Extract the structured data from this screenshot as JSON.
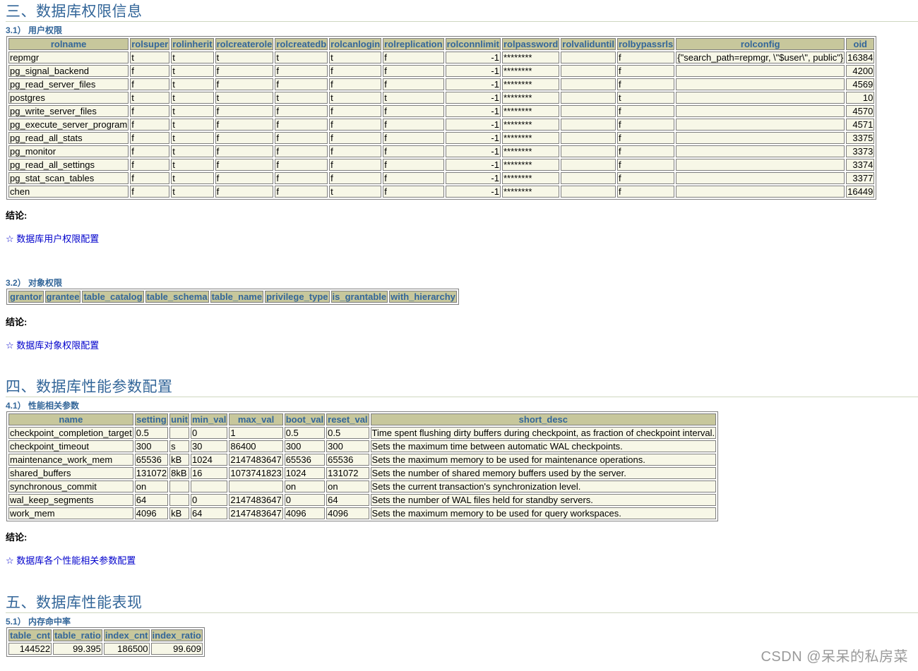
{
  "s3": {
    "title": "三、数据库权限信息",
    "s31": {
      "title": "3.1） 用户权限",
      "headers": [
        "rolname",
        "rolsuper",
        "rolinherit",
        "rolcreaterole",
        "rolcreatedb",
        "rolcanlogin",
        "rolreplication",
        "rolconnlimit",
        "rolpassword",
        "rolvaliduntil",
        "rolbypassrls",
        "rolconfig",
        "oid"
      ],
      "rows": [
        [
          "repmgr",
          "t",
          "t",
          "t",
          "t",
          "t",
          "f",
          "-1",
          "********",
          "",
          "f",
          "{\"search_path=repmgr, \\\"$user\\\", public\"}",
          "16384"
        ],
        [
          "pg_signal_backend",
          "f",
          "t",
          "f",
          "f",
          "f",
          "f",
          "-1",
          "********",
          "",
          "f",
          "",
          "4200"
        ],
        [
          "pg_read_server_files",
          "f",
          "t",
          "f",
          "f",
          "f",
          "f",
          "-1",
          "********",
          "",
          "f",
          "",
          "4569"
        ],
        [
          "postgres",
          "t",
          "t",
          "t",
          "t",
          "t",
          "t",
          "-1",
          "********",
          "",
          "t",
          "",
          "10"
        ],
        [
          "pg_write_server_files",
          "f",
          "t",
          "f",
          "f",
          "f",
          "f",
          "-1",
          "********",
          "",
          "f",
          "",
          "4570"
        ],
        [
          "pg_execute_server_program",
          "f",
          "t",
          "f",
          "f",
          "f",
          "f",
          "-1",
          "********",
          "",
          "f",
          "",
          "4571"
        ],
        [
          "pg_read_all_stats",
          "f",
          "t",
          "f",
          "f",
          "f",
          "f",
          "-1",
          "********",
          "",
          "f",
          "",
          "3375"
        ],
        [
          "pg_monitor",
          "f",
          "t",
          "f",
          "f",
          "f",
          "f",
          "-1",
          "********",
          "",
          "f",
          "",
          "3373"
        ],
        [
          "pg_read_all_settings",
          "f",
          "t",
          "f",
          "f",
          "f",
          "f",
          "-1",
          "********",
          "",
          "f",
          "",
          "3374"
        ],
        [
          "pg_stat_scan_tables",
          "f",
          "t",
          "f",
          "f",
          "f",
          "f",
          "-1",
          "********",
          "",
          "f",
          "",
          "3377"
        ],
        [
          "chen",
          "f",
          "t",
          "f",
          "f",
          "t",
          "f",
          "-1",
          "********",
          "",
          "f",
          "",
          "16449"
        ]
      ],
      "conclusion": "结论:",
      "link": "数据库用户权限配置"
    },
    "s32": {
      "title": "3.2） 对象权限",
      "headers": [
        "grantor",
        "grantee",
        "table_catalog",
        "table_schema",
        "table_name",
        "privilege_type",
        "is_grantable",
        "with_hierarchy"
      ],
      "conclusion": "结论:",
      "link": "数据库对象权限配置"
    }
  },
  "s4": {
    "title": "四、数据库性能参数配置",
    "s41": {
      "title": "4.1） 性能相关参数",
      "headers": [
        "name",
        "setting",
        "unit",
        "min_val",
        "max_val",
        "boot_val",
        "reset_val",
        "short_desc"
      ],
      "rows": [
        [
          "checkpoint_completion_target",
          "0.5",
          "",
          "0",
          "1",
          "0.5",
          "0.5",
          "Time spent flushing dirty buffers during checkpoint, as fraction of checkpoint interval."
        ],
        [
          "checkpoint_timeout",
          "300",
          "s",
          "30",
          "86400",
          "300",
          "300",
          "Sets the maximum time between automatic WAL checkpoints."
        ],
        [
          "maintenance_work_mem",
          "65536",
          "kB",
          "1024",
          "2147483647",
          "65536",
          "65536",
          "Sets the maximum memory to be used for maintenance operations."
        ],
        [
          "shared_buffers",
          "131072",
          "8kB",
          "16",
          "1073741823",
          "1024",
          "131072",
          "Sets the number of shared memory buffers used by the server."
        ],
        [
          "synchronous_commit",
          "on",
          "",
          "",
          "",
          "on",
          "on",
          "Sets the current transaction's synchronization level."
        ],
        [
          "wal_keep_segments",
          "64",
          "",
          "0",
          "2147483647",
          "0",
          "64",
          "Sets the number of WAL files held for standby servers."
        ],
        [
          "work_mem",
          "4096",
          "kB",
          "64",
          "2147483647",
          "4096",
          "4096",
          "Sets the maximum memory to be used for query workspaces."
        ]
      ],
      "conclusion": "结论:",
      "link": "数据库各个性能相关参数配置"
    }
  },
  "s5": {
    "title": "五、数据库性能表现",
    "s51": {
      "title": "5.1） 内存命中率",
      "headers": [
        "table_cnt",
        "table_ratio",
        "index_cnt",
        "index_ratio"
      ],
      "rows": [
        [
          "144522",
          "99.395",
          "186500",
          "99.609"
        ]
      ]
    }
  },
  "star": "☆",
  "watermark": "CSDN @呆呆的私房菜"
}
